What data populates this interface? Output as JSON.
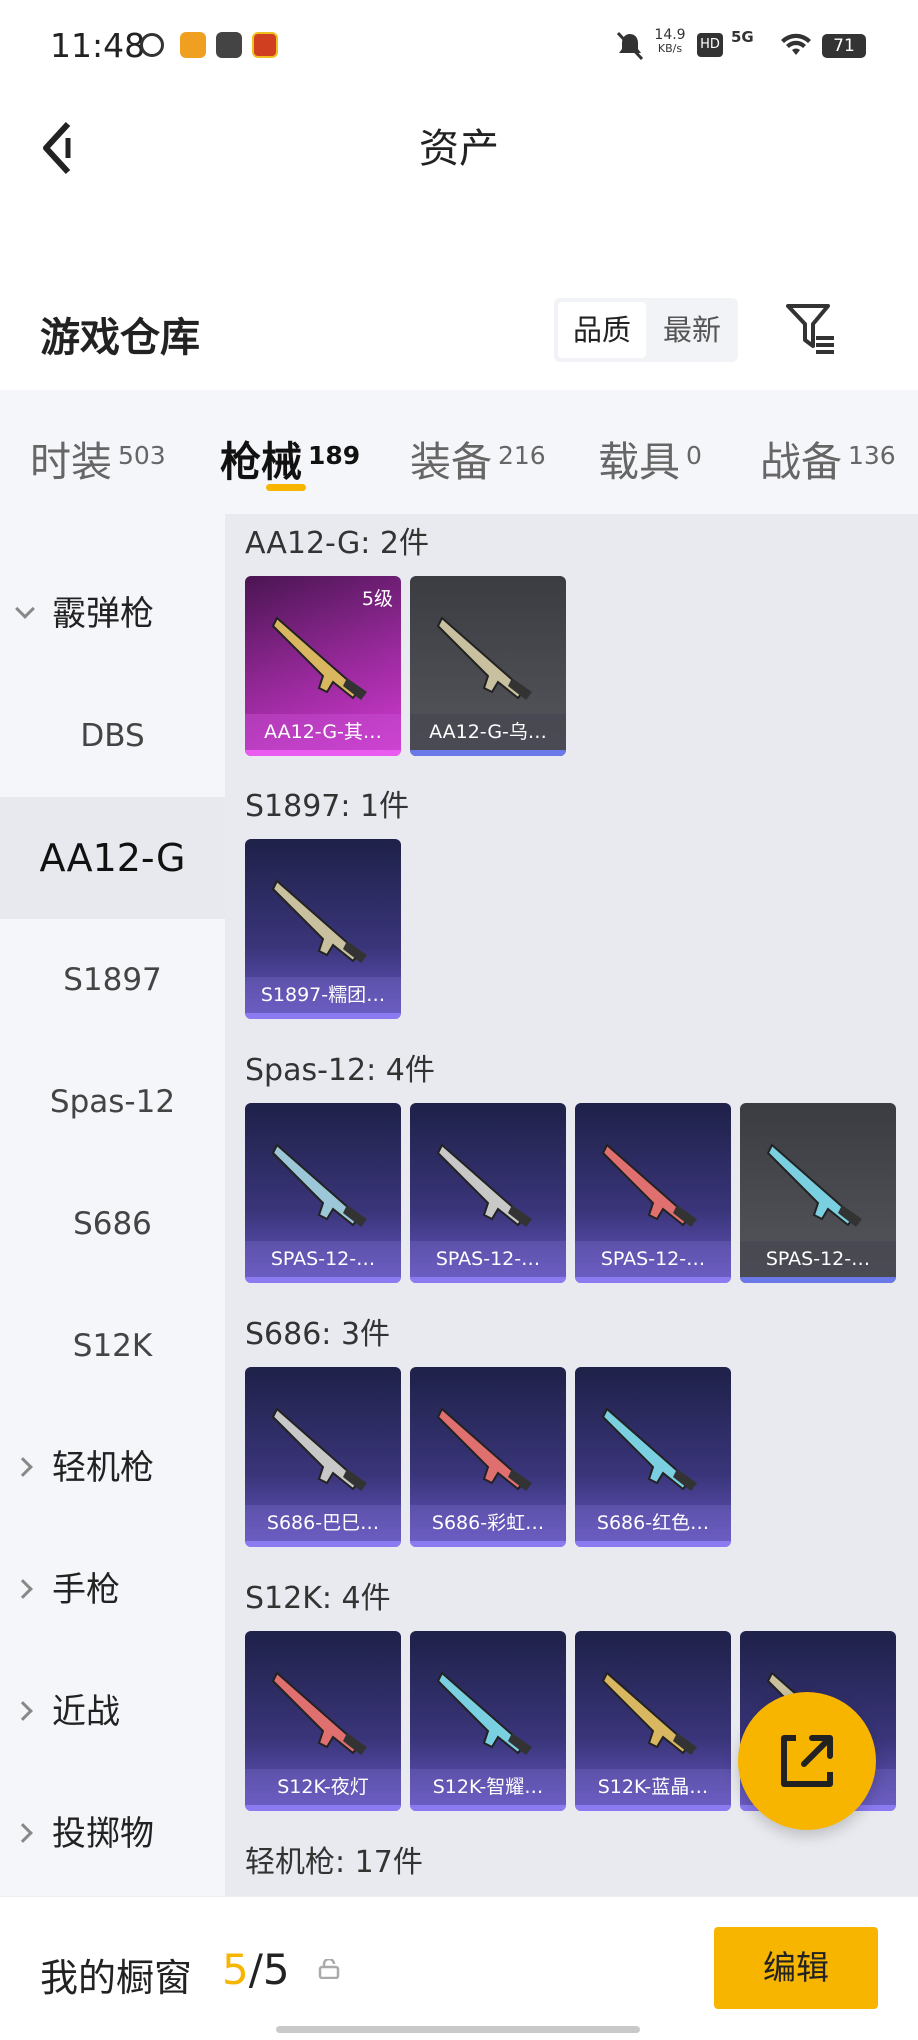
{
  "status_bar": {
    "time": "11:48",
    "net_speed": "14.9",
    "net_unit": "KB/s",
    "hd": "HD",
    "signal": "5G",
    "battery": "71"
  },
  "header": {
    "title": "资产"
  },
  "warehouse": {
    "title": "游戏仓库",
    "sort_options": [
      "品质",
      "最新"
    ],
    "selected_sort": "品质"
  },
  "tabs": [
    {
      "label": "时装",
      "count": "503"
    },
    {
      "label": "枪械",
      "count": "189",
      "active": true
    },
    {
      "label": "装备",
      "count": "216"
    },
    {
      "label": "载具",
      "count": "0"
    },
    {
      "label": "战备",
      "count": "136"
    }
  ],
  "sidebar": {
    "items": [
      {
        "label": "霰弹枪",
        "kind": "category",
        "expanded": true
      },
      {
        "label": "DBS",
        "kind": "sub"
      },
      {
        "label": "AA12-G",
        "kind": "sub",
        "selected": true
      },
      {
        "label": "S1897",
        "kind": "sub"
      },
      {
        "label": "Spas-12",
        "kind": "sub"
      },
      {
        "label": "S686",
        "kind": "sub"
      },
      {
        "label": "S12K",
        "kind": "sub"
      },
      {
        "label": "轻机枪",
        "kind": "category"
      },
      {
        "label": "手枪",
        "kind": "category"
      },
      {
        "label": "近战",
        "kind": "category"
      },
      {
        "label": "投掷物",
        "kind": "category"
      }
    ]
  },
  "groups": [
    {
      "title": "AA12-G: 2件",
      "items": [
        {
          "name": "AA12-G-其…",
          "style": "purple",
          "level": "5级"
        },
        {
          "name": "AA12-G-乌…",
          "style": "gray"
        }
      ]
    },
    {
      "title": "S1897: 1件",
      "items": [
        {
          "name": "S1897-糯团…",
          "style": "blue"
        }
      ]
    },
    {
      "title": "Spas-12: 4件",
      "items": [
        {
          "name": "SPAS-12-…",
          "style": "blue"
        },
        {
          "name": "SPAS-12-…",
          "style": "blue"
        },
        {
          "name": "SPAS-12-…",
          "style": "blue"
        },
        {
          "name": "SPAS-12-…",
          "style": "gray"
        }
      ]
    },
    {
      "title": "S686: 3件",
      "items": [
        {
          "name": "S686-巴巳…",
          "style": "blue"
        },
        {
          "name": "S686-彩虹…",
          "style": "blue"
        },
        {
          "name": "S686-红色…",
          "style": "blue"
        }
      ]
    },
    {
      "title": "S12K: 4件",
      "items": [
        {
          "name": "S12K-夜灯",
          "style": "blue"
        },
        {
          "name": "S12K-智耀…",
          "style": "blue"
        },
        {
          "name": "S12K-蓝晶…",
          "style": "blue"
        },
        {
          "name": "",
          "style": "blue"
        }
      ]
    },
    {
      "title": "轻机枪: 17件",
      "items": []
    }
  ],
  "bottom_bar": {
    "label": "我的橱窗",
    "count_current": "5",
    "count_sep": "/",
    "count_total": "5",
    "edit_label": "编辑"
  },
  "colors": {
    "accent": "#f7b500",
    "panel_bg": "#f5f6fa",
    "content_bg": "#e8eaef",
    "card_blue": "#3a357a",
    "card_purple": "#9b2a9e",
    "card_gray": "#55575d"
  },
  "icons": {
    "back": "chevron-left-icon",
    "filter": "filter-list-icon",
    "fab": "share-external-icon",
    "lock": "lock-icon"
  }
}
